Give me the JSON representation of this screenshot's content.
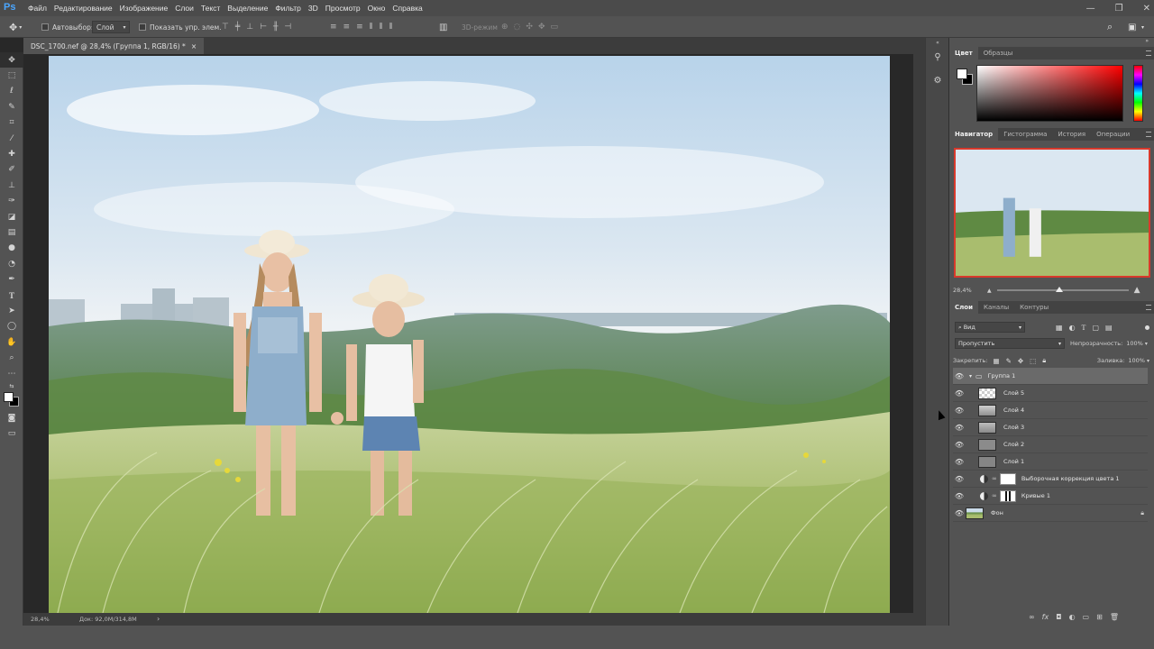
{
  "app": {
    "logo": "Ps",
    "menu": [
      "Файл",
      "Редактирование",
      "Изображение",
      "Слои",
      "Текст",
      "Выделение",
      "Фильтр",
      "3D",
      "Просмотр",
      "Окно",
      "Справка"
    ],
    "window_controls": {
      "minimize": "—",
      "restore": "❐",
      "close": "✕"
    }
  },
  "options": {
    "autoselect_label": "Автовыбор:",
    "autoselect_target": "Слой",
    "show_transform_label": "Показать упр. элем.",
    "mode_3d": "3D-режим"
  },
  "document_tab": {
    "title": "DSC_1700.nef @ 28,4% (Группа 1, RGB/16) *",
    "close": "×"
  },
  "status": {
    "zoom": "28,4%",
    "doc_info": "Док: 92,0M/314,8M",
    "arrow": "›"
  },
  "color_panel": {
    "tabs": [
      "Цвет",
      "Образцы"
    ],
    "foreground": "#ffffff",
    "background": "#000000",
    "hue": "#ff0000"
  },
  "navigator_panel": {
    "tabs": [
      "Навигатор",
      "Гистограмма",
      "История",
      "Операции"
    ],
    "zoom": "28,4%"
  },
  "layers_panel": {
    "tabs": [
      "Слои",
      "Каналы",
      "Контуры"
    ],
    "filter_label": "Вид",
    "blend_mode": "Пропустить",
    "opacity_label": "Непрозрачность:",
    "opacity_value": "100%",
    "lock_label": "Закрепить:",
    "fill_label": "Заливка:",
    "fill_value": "100%",
    "layers": [
      {
        "name": "Группа 1",
        "kind": "group"
      },
      {
        "name": "Слой 5",
        "kind": "transparent"
      },
      {
        "name": "Слой 4",
        "kind": "light"
      },
      {
        "name": "Слой 3",
        "kind": "light"
      },
      {
        "name": "Слой 2",
        "kind": "gray"
      },
      {
        "name": "Слой 1",
        "kind": "gray"
      },
      {
        "name": "Выборочная коррекция цвета 1",
        "kind": "adjustment"
      },
      {
        "name": "Кривые 1",
        "kind": "adjustment"
      },
      {
        "name": "Фон",
        "kind": "background"
      }
    ],
    "footer_icons": [
      "link-icon",
      "fx-icon",
      "mask-icon",
      "adjustment-icon",
      "folder-icon",
      "new-layer-icon",
      "trash-icon"
    ]
  },
  "tools": [
    "move",
    "marquee",
    "lasso",
    "quick-select",
    "crop",
    "eyedropper",
    "healing",
    "brush",
    "stamp",
    "history-brush",
    "eraser",
    "gradient",
    "blur",
    "dodge",
    "pen",
    "type",
    "path-select",
    "shape",
    "hand",
    "zoom",
    "more",
    "swap-colors",
    "fg-bg-colors",
    "quick-mask",
    "screen-mode"
  ]
}
